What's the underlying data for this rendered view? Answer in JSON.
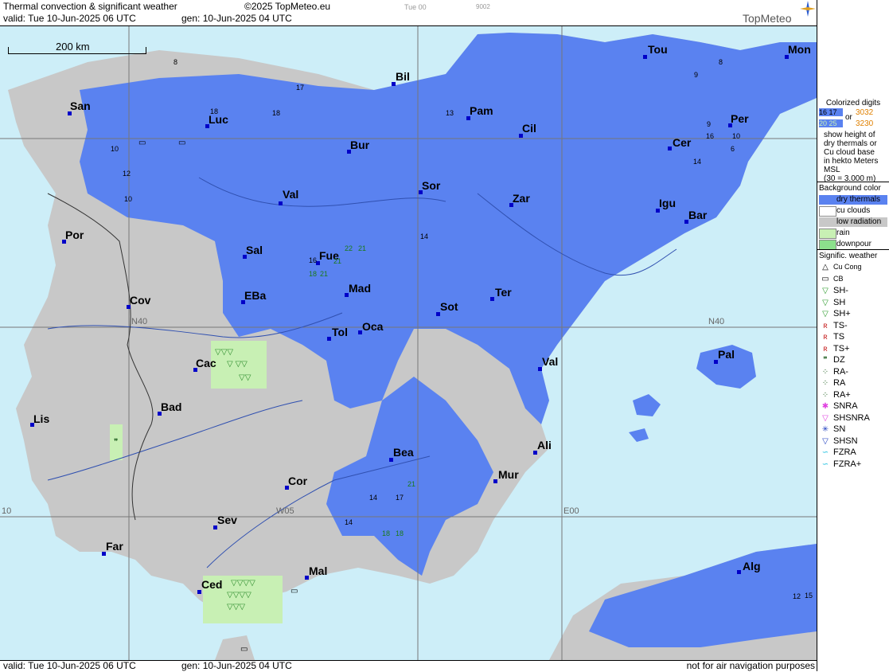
{
  "header": {
    "title": "Thermal convection & significant weather",
    "copyright": "©2025 TopMeteo.eu",
    "timecode": "Tue 00",
    "code": "9002",
    "valid": "valid:  Tue  10-Jun-2025  06 UTC",
    "generated": "gen: 10-Jun-2025 04 UTC",
    "logo": "TopMeteo"
  },
  "scale": {
    "label": "200 km"
  },
  "grid_labels": {
    "n40_left": "N40",
    "n40_right": "N40",
    "w05": "W05",
    "e00": "E00",
    "w10": "10"
  },
  "cities": [
    {
      "id": "san",
      "name": "San"
    },
    {
      "id": "luc",
      "name": "Luc"
    },
    {
      "id": "bil",
      "name": "Bil"
    },
    {
      "id": "tou",
      "name": "Tou"
    },
    {
      "id": "mon",
      "name": "Mon"
    },
    {
      "id": "pam",
      "name": "Pam"
    },
    {
      "id": "per",
      "name": "Per"
    },
    {
      "id": "bur",
      "name": "Bur"
    },
    {
      "id": "cil",
      "name": "Cil"
    },
    {
      "id": "cer",
      "name": "Cer"
    },
    {
      "id": "val_n",
      "name": "Val"
    },
    {
      "id": "sor",
      "name": "Sor"
    },
    {
      "id": "zar",
      "name": "Zar"
    },
    {
      "id": "igu",
      "name": "Igu"
    },
    {
      "id": "bar",
      "name": "Bar"
    },
    {
      "id": "por",
      "name": "Por"
    },
    {
      "id": "sal",
      "name": "Sal"
    },
    {
      "id": "fue",
      "name": "Fue"
    },
    {
      "id": "mad",
      "name": "Mad"
    },
    {
      "id": "ter",
      "name": "Ter"
    },
    {
      "id": "cov",
      "name": "Cov"
    },
    {
      "id": "eba",
      "name": "EBa"
    },
    {
      "id": "sot",
      "name": "Sot"
    },
    {
      "id": "tol",
      "name": "Tol"
    },
    {
      "id": "oca",
      "name": "Oca"
    },
    {
      "id": "pal",
      "name": "Pal"
    },
    {
      "id": "cac",
      "name": "Cac"
    },
    {
      "id": "val_e",
      "name": "Val"
    },
    {
      "id": "bad",
      "name": "Bad"
    },
    {
      "id": "lis",
      "name": "Lis"
    },
    {
      "id": "ali",
      "name": "Ali"
    },
    {
      "id": "bea",
      "name": "Bea"
    },
    {
      "id": "mur",
      "name": "Mur"
    },
    {
      "id": "cor",
      "name": "Cor"
    },
    {
      "id": "sev",
      "name": "Sev"
    },
    {
      "id": "far",
      "name": "Far"
    },
    {
      "id": "alg",
      "name": "Alg"
    },
    {
      "id": "mal",
      "name": "Mal"
    },
    {
      "id": "ced",
      "name": "Ced"
    }
  ],
  "thermal_digits": [
    "8",
    "17",
    "18",
    "18",
    "13",
    "9",
    "8",
    "9",
    "16",
    "10",
    "6",
    "14",
    "10",
    "12",
    "10",
    "14",
    "22",
    "21",
    "16",
    "21",
    "18",
    "21",
    "21",
    "14",
    "17",
    "14",
    "18",
    "18",
    "12",
    "15"
  ],
  "legend": {
    "colorized_title": "Colorized digits",
    "sample_a": "16 17",
    "sample_b": "20 25",
    "or": "or",
    "sample_c": "3032",
    "sample_d": "3230",
    "explain": [
      "show height of",
      "dry thermals or",
      "Cu cloud base",
      "in hekto Meters",
      "MSL",
      "(30 = 3.000 m)"
    ],
    "background_title": "Background color",
    "backgrounds": [
      {
        "label": "dry thermals",
        "color": "#5a82f0"
      },
      {
        "label": "cu clouds",
        "color": "#ffffff"
      },
      {
        "label": "low radiation",
        "color": "#c8c8c8"
      },
      {
        "label": "rain",
        "color": "#c8f0b4"
      },
      {
        "label": "downpour",
        "color": "#8ce08c"
      }
    ],
    "weather_title": "Signific. weather",
    "weather": [
      {
        "label": "Cu Cong",
        "icon": "cu-cong-icon",
        "color": "#000000"
      },
      {
        "label": "CB",
        "icon": "cb-icon",
        "color": "#000000"
      },
      {
        "label": "SH-",
        "icon": "shower-light-icon",
        "color": "#2a9a2a"
      },
      {
        "label": "SH",
        "icon": "shower-icon",
        "color": "#2a9a2a"
      },
      {
        "label": "SH+",
        "icon": "shower-heavy-icon",
        "color": "#2a9a2a"
      },
      {
        "label": "TS-",
        "icon": "ts-light-icon",
        "color": "#c82828"
      },
      {
        "label": "TS",
        "icon": "ts-icon",
        "color": "#c82828"
      },
      {
        "label": "TS+",
        "icon": "ts-heavy-icon",
        "color": "#c82828"
      },
      {
        "label": "DZ",
        "icon": "drizzle-icon",
        "color": "#1a5a1a"
      },
      {
        "label": "RA-",
        "icon": "rain-light-icon",
        "color": "#1a5a1a"
      },
      {
        "label": "RA",
        "icon": "rain-icon",
        "color": "#1a5a1a"
      },
      {
        "label": "RA+",
        "icon": "rain-heavy-icon",
        "color": "#1a5a1a"
      },
      {
        "label": "SNRA",
        "icon": "snra-icon",
        "color": "#e040e0"
      },
      {
        "label": "SHSNRA",
        "icon": "shsnra-icon",
        "color": "#e040e0"
      },
      {
        "label": "SN",
        "icon": "snow-icon",
        "color": "#2040c0"
      },
      {
        "label": "SHSN",
        "icon": "shsn-icon",
        "color": "#2040c0"
      },
      {
        "label": "FZRA",
        "icon": "fzra-icon",
        "color": "#20c0e0"
      },
      {
        "label": "FZRA+",
        "icon": "fzra-heavy-icon",
        "color": "#20c0e0"
      }
    ]
  },
  "footer": {
    "valid": "valid:  Tue  10-Jun-2025  06 UTC",
    "generated": "gen: 10-Jun-2025 04 UTC",
    "disclaimer": "not for air navigation purposes"
  }
}
